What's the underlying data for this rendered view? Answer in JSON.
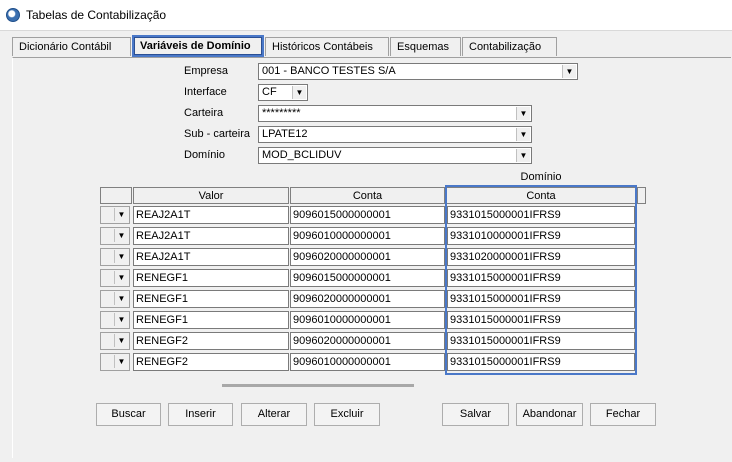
{
  "window": {
    "title": "Tabelas de Contabilização"
  },
  "tabs": [
    {
      "label": "Dicionário Contábil"
    },
    {
      "label": "Variáveis de Domínio",
      "active": true
    },
    {
      "label": "Históricos Contábeis"
    },
    {
      "label": "Esquemas"
    },
    {
      "label": "Contabilização"
    }
  ],
  "form": {
    "empresa": {
      "label": "Empresa",
      "value": "001 - BANCO TESTES S/A"
    },
    "interface": {
      "label": "Interface",
      "value": "CF"
    },
    "carteira": {
      "label": "Carteira",
      "value": "*********"
    },
    "subcarteira": {
      "label": "Sub - carteira",
      "value": "LPATE12"
    },
    "dominio": {
      "label": "Domínio",
      "value": "MOD_BCLIDUV"
    }
  },
  "grid": {
    "group_header": "Domínio",
    "columns": [
      "Valor",
      "Conta",
      "Conta"
    ],
    "rows": [
      {
        "valor": "REAJ2A1T",
        "conta": "9096015000000001",
        "conta_dominio": "9331015000001IFRS9"
      },
      {
        "valor": "REAJ2A1T",
        "conta": "9096010000000001",
        "conta_dominio": "9331010000001IFRS9"
      },
      {
        "valor": "REAJ2A1T",
        "conta": "9096020000000001",
        "conta_dominio": "9331020000001IFRS9"
      },
      {
        "valor": "RENEGF1",
        "conta": "9096015000000001",
        "conta_dominio": "9331015000001IFRS9"
      },
      {
        "valor": "RENEGF1",
        "conta": "9096020000000001",
        "conta_dominio": "9331015000001IFRS9"
      },
      {
        "valor": "RENEGF1",
        "conta": "9096010000000001",
        "conta_dominio": "9331015000001IFRS9"
      },
      {
        "valor": "RENEGF2",
        "conta": "9096020000000001",
        "conta_dominio": "9331015000001IFRS9"
      },
      {
        "valor": "RENEGF2",
        "conta": "9096010000000001",
        "conta_dominio": "9331015000001IFRS9"
      }
    ]
  },
  "buttons": {
    "buscar": "Buscar",
    "inserir": "Inserir",
    "alterar": "Alterar",
    "excluir": "Excluir",
    "salvar": "Salvar",
    "abandonar": "Abandonar",
    "fechar": "Fechar"
  },
  "colors": {
    "highlight": "#4a78c8"
  }
}
